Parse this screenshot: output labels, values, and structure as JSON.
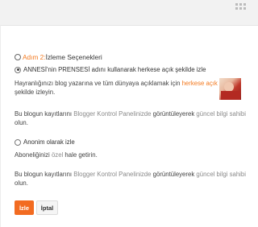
{
  "heading": {
    "step": "Adım 2:",
    "title": " İzleme Seçenekleri"
  },
  "option_public": {
    "label": "ANNESİ'nin PRENSESİ adını kullanarak herkese açık şekilde izle"
  },
  "public_description": {
    "part1": "Hayranlığınızı blog yazarına ve tüm dünyaya açıklamak için ",
    "highlight": "herkese açık",
    "part2": " olacak",
    "line2": "şekilde izleyin."
  },
  "public_note": {
    "part1": "Bu blogun kayıtlarını ",
    "panel": "Blogger Kontrol Panelinizde",
    "part2": " görüntüleyerek ",
    "updated": "güncel bilgi sahibi",
    "line2": "olun."
  },
  "option_anonymous": {
    "label": "Anonim olarak izle"
  },
  "anonymous_description": {
    "part1": "Aboneliğinizi ",
    "highlight": "özel",
    "part2": " hale getirin."
  },
  "anonymous_note": {
    "part1": "Bu blogun kayıtlarını ",
    "panel": "Blogger Kontrol Panelinizde",
    "part2": " görüntüleyerek ",
    "updated": "güncel bilgi sahibi",
    "line2": "olun."
  },
  "buttons": {
    "follow": "İzle",
    "cancel": "İptal"
  },
  "colors": {
    "accent": "#f37a20",
    "primary_button": "#f26b21"
  }
}
